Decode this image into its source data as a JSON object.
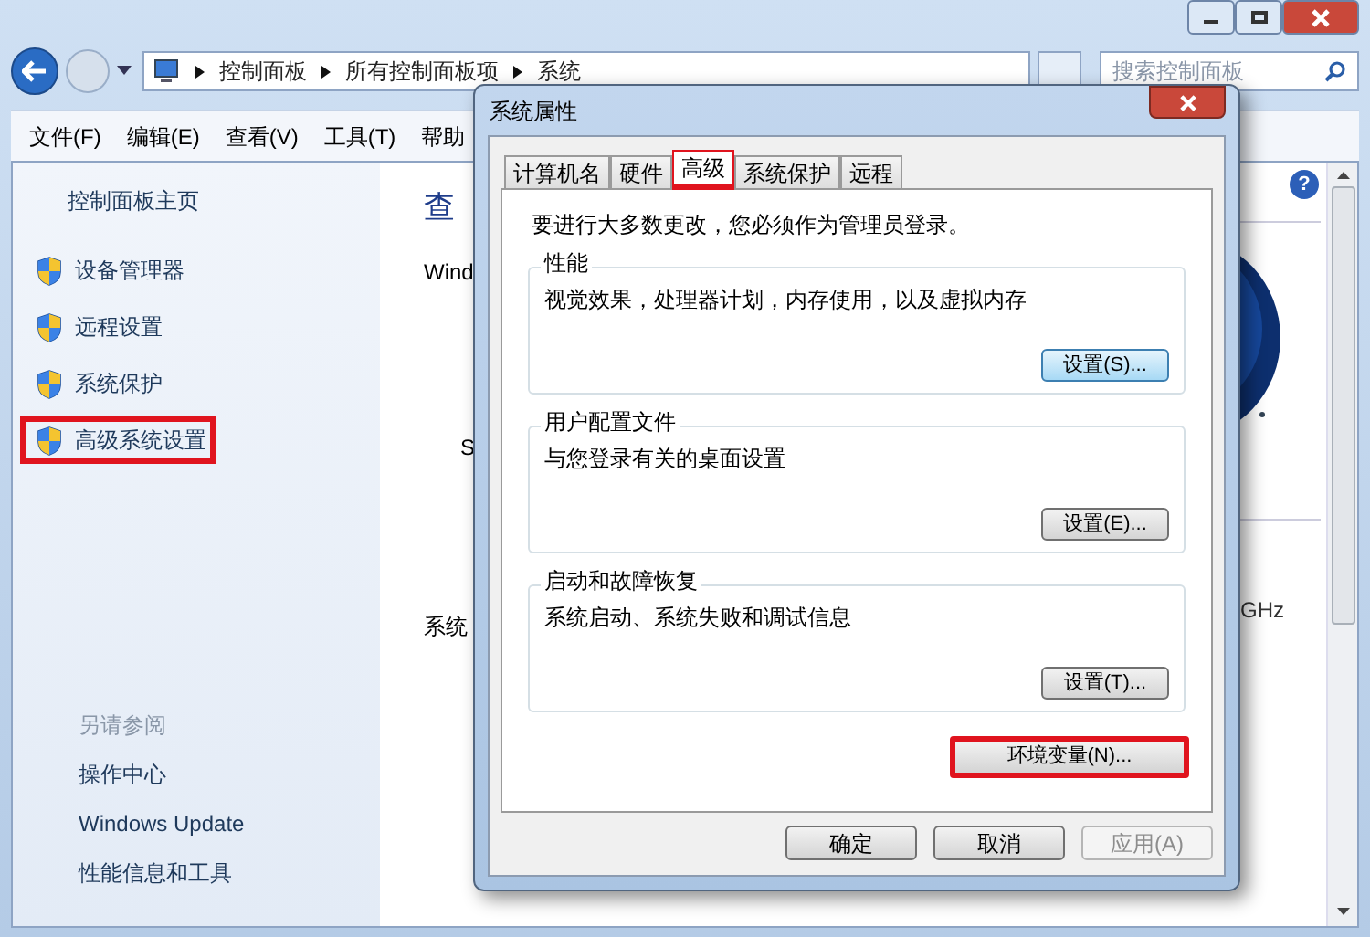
{
  "window": {
    "breadcrumbs": [
      "控制面板",
      "所有控制面板项",
      "系统"
    ],
    "search": {
      "placeholder": "搜索控制面板"
    }
  },
  "menu": [
    "文件(F)",
    "编辑(E)",
    "查看(V)",
    "工具(T)",
    "帮助"
  ],
  "sidebar": {
    "home": "控制面板主页",
    "items": [
      {
        "label": "设备管理器",
        "highlighted": false
      },
      {
        "label": "远程设置",
        "highlighted": false
      },
      {
        "label": "系统保护",
        "highlighted": false
      },
      {
        "label": "高级系统设置",
        "highlighted": true
      }
    ],
    "see_also_title": "另请参阅",
    "see_also": [
      "操作中心",
      "Windows Update",
      "性能信息和工具"
    ]
  },
  "main": {
    "heading": "查",
    "help": "?",
    "sections": [
      {
        "title": "Wind",
        "lines": [
          "S"
        ]
      },
      {
        "title": "系统"
      }
    ],
    "speed_fragment": "GHz"
  },
  "dialog": {
    "title": "系统属性",
    "tabs": [
      {
        "label": "计算机名",
        "selected": false,
        "highlighted": false
      },
      {
        "label": "硬件",
        "selected": false,
        "highlighted": false
      },
      {
        "label": "高级",
        "selected": true,
        "highlighted": true
      },
      {
        "label": "系统保护",
        "selected": false,
        "highlighted": false
      },
      {
        "label": "远程",
        "selected": false,
        "highlighted": false
      }
    ],
    "notice": "要进行大多数更改，您必须作为管理员登录。",
    "groups": [
      {
        "title": "性能",
        "description": "视觉效果，处理器计划，内存使用，以及虚拟内存",
        "button": "设置(S)...",
        "focused": true
      },
      {
        "title": "用户配置文件",
        "description": "与您登录有关的桌面设置",
        "button": "设置(E)...",
        "focused": false
      },
      {
        "title": "启动和故障恢复",
        "description": "系统启动、系统失败和调试信息",
        "button": "设置(T)...",
        "focused": false
      }
    ],
    "env_button": {
      "label": "环境变量(N)...",
      "highlighted": true
    },
    "buttons": [
      {
        "label": "确定",
        "disabled": false
      },
      {
        "label": "取消",
        "disabled": false
      },
      {
        "label": "应用(A)",
        "disabled": true
      }
    ]
  }
}
